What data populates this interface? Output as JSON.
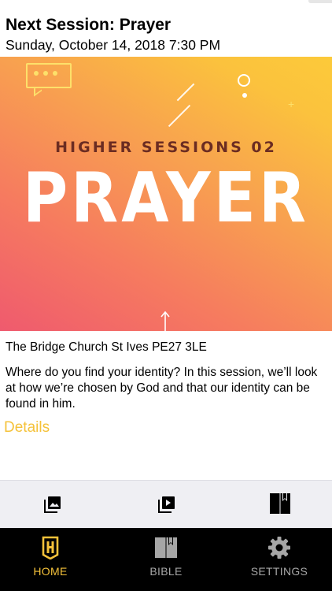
{
  "session": {
    "title": "Next Session: Prayer",
    "datetime": "Sunday, October 14, 2018 7:30 PM",
    "banner_kicker": "HIGHER SESSIONS 02",
    "banner_title": "PRAYER",
    "location": "The Bridge Church St Ives PE27 3LE",
    "description": "Where do you find your identity? In this session, we’ll look at how we’re chosen by God and that our identity can be found in him.",
    "details_link": "Details"
  },
  "toolbar": {
    "icons": [
      "photo-library-icon",
      "video-library-icon",
      "book-bookmark-icon"
    ]
  },
  "tabs": [
    {
      "label": "HOME",
      "icon": "home-h-icon",
      "active": true
    },
    {
      "label": "BIBLE",
      "icon": "bible-icon",
      "active": false
    },
    {
      "label": "SETTINGS",
      "icon": "gear-icon",
      "active": false
    }
  ],
  "colors": {
    "accent": "#f5c23a",
    "tab_inactive": "#a6a6a6",
    "tabbar_bg": "#000000"
  }
}
